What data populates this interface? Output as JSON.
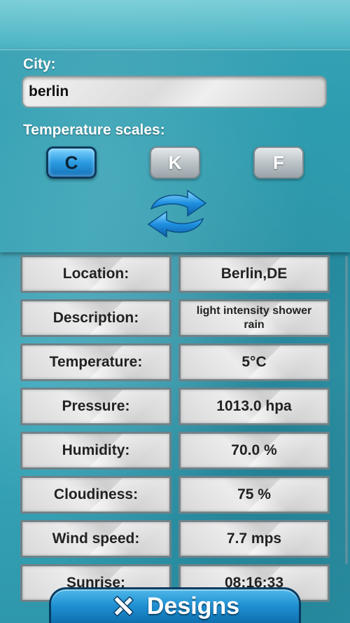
{
  "city": {
    "label": "City:",
    "value": "berlin"
  },
  "scales": {
    "label": "Temperature scales:",
    "options": [
      {
        "label": "C",
        "active": true
      },
      {
        "label": "K",
        "active": false
      },
      {
        "label": "F",
        "active": false
      }
    ]
  },
  "refresh_icon": "refresh-arrows-icon",
  "weather": [
    {
      "label": "Location:",
      "value": "Berlin,DE"
    },
    {
      "label": "Description:",
      "value": "light intensity shower rain"
    },
    {
      "label": "Temperature:",
      "value": "5°C"
    },
    {
      "label": "Pressure:",
      "value": "1013.0 hpa"
    },
    {
      "label": "Humidity:",
      "value": "70.0 %"
    },
    {
      "label": "Cloudiness:",
      "value": "75 %"
    },
    {
      "label": "Wind speed:",
      "value": "7.7 mps"
    },
    {
      "label": "Sunrise:",
      "value": "08:16:33"
    }
  ],
  "bottom_tab": {
    "label": "Designs",
    "icon": "pencil-ruler-icon"
  },
  "colors": {
    "accent": "#1f8fd2",
    "background": "#2fa2b6"
  }
}
